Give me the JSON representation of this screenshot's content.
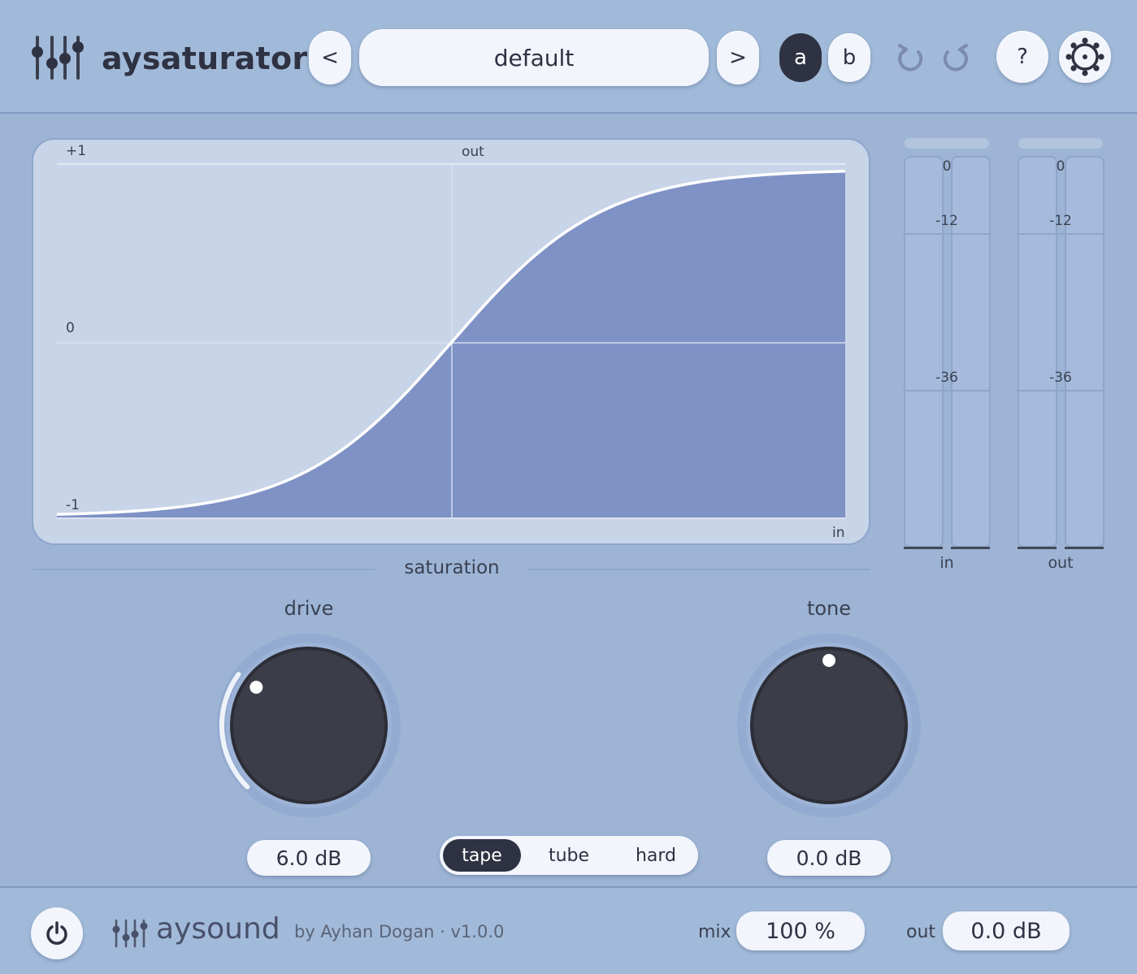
{
  "header": {
    "app_name": "aysaturator",
    "prev_label": "<",
    "next_label": ">",
    "preset_name": "default",
    "ab": {
      "a": "a",
      "b": "b",
      "selected": "a"
    },
    "help_label": "?"
  },
  "graph": {
    "label_top": "+1",
    "label_mid": "0",
    "label_bottom": "-1",
    "axis_out": "out",
    "axis_in": "in",
    "curve_type": "tanh saturation curve"
  },
  "meters": {
    "ticks": [
      "0",
      "-12",
      "-36"
    ],
    "input": {
      "name": "in"
    },
    "output": {
      "name": "out"
    }
  },
  "saturation": {
    "section_title": "saturation",
    "drive": {
      "label": "drive",
      "value": "6.0 dB",
      "position": 0.3
    },
    "tone": {
      "label": "tone",
      "value": "0.0 dB",
      "position": 0.5
    },
    "modes": [
      "tape",
      "tube",
      "hard"
    ],
    "selected_mode": "tape"
  },
  "footer": {
    "brand": "aysound",
    "by_line": "by Ayhan Dogan · v1.0.0",
    "mix_label": "mix",
    "mix_value": "100 %",
    "out_label": "out",
    "out_value": "0.0 dB"
  },
  "colors": {
    "background": "#9db4d5",
    "panel": "#c8d4e8",
    "curve_fill": "#7f92c6",
    "knob": "#383a45",
    "dark_accent": "#2e3242"
  },
  "icons": [
    "sliders-logo-icon",
    "undo-icon",
    "redo-icon",
    "help-icon",
    "settings-icon",
    "power-icon"
  ]
}
